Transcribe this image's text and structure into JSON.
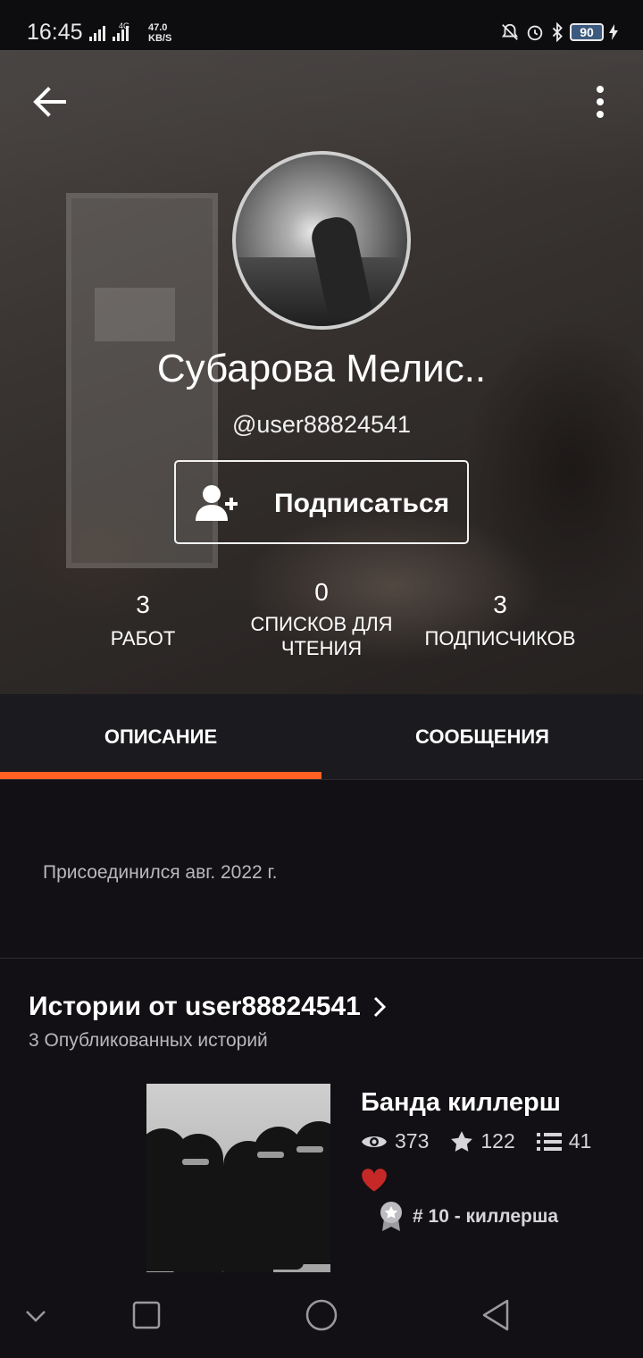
{
  "status_bar": {
    "time": "16:45",
    "network": "4G",
    "speed_value": "47.0",
    "speed_unit": "KB/S",
    "battery": "90"
  },
  "header": {
    "name": "Субарова Мелис..",
    "handle": "@user88824541",
    "follow_label": "Подписаться",
    "stats": [
      {
        "number": "3",
        "label": "РАБОТ"
      },
      {
        "number": "0",
        "label": "СПИСКОВ ДЛЯ ЧТЕНИЯ"
      },
      {
        "number": "3",
        "label": "ПОДПИСЧИКОВ"
      }
    ]
  },
  "tabs": [
    {
      "label": "ОПИСАНИЕ",
      "active": true
    },
    {
      "label": "СООБЩЕНИЯ",
      "active": false
    }
  ],
  "about": {
    "joined": "Присоединился авг. 2022 г."
  },
  "stories": {
    "title": "Истории от user88824541",
    "subtitle": "3 Опубликованных историй",
    "items": [
      {
        "title": "Банда киллерш",
        "views": "373",
        "votes": "122",
        "parts": "41",
        "rank": "# 10 - киллерша"
      }
    ]
  },
  "colors": {
    "accent": "#ff6122",
    "background": "#121014",
    "tab_bar": "#1b1a1e",
    "heart": "#c62828"
  },
  "icons": [
    "back-arrow-icon",
    "more-vert-icon",
    "add-user-icon",
    "eye-icon",
    "star-icon",
    "list-icon",
    "heart-icon",
    "rank-badge-icon",
    "chevron-right-icon"
  ]
}
